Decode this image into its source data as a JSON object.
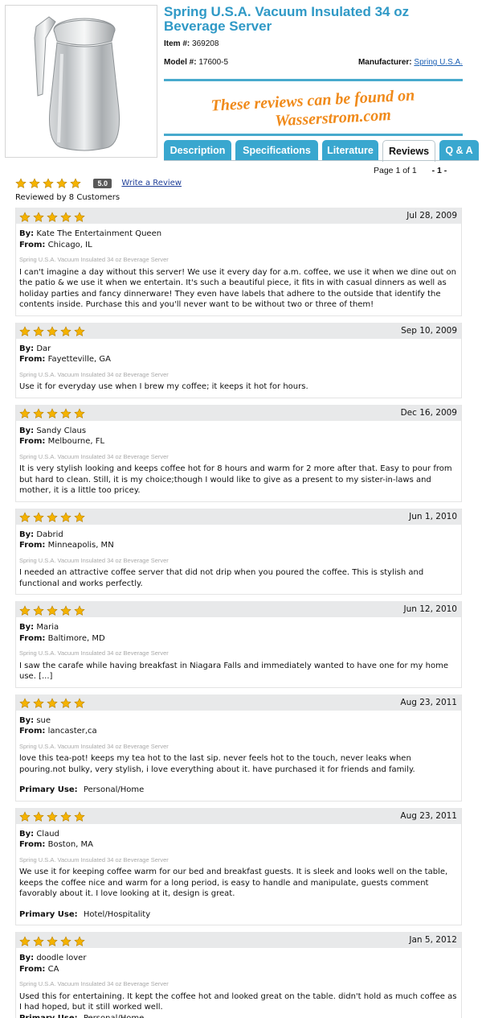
{
  "product": {
    "title": "Spring U.S.A. Vacuum Insulated 34 oz Beverage Server",
    "item_label": "Item #:",
    "item_number": "369208",
    "model_label": "Model #:",
    "model_number": "17600-5",
    "manufacturer_label": "Manufacturer:",
    "manufacturer": "Spring U.S.A."
  },
  "watermark": {
    "line1": "These reviews can be found on",
    "line2": "Wasserstrom.com",
    "color": "#f08a1a"
  },
  "tabs": [
    {
      "label": "Description",
      "active": false
    },
    {
      "label": "Specifications",
      "active": false
    },
    {
      "label": "Literature",
      "active": false
    },
    {
      "label": "Reviews",
      "active": true
    },
    {
      "label": "Q & A",
      "active": false
    }
  ],
  "pager": {
    "text": "Page 1 of 1",
    "current": "- 1 -"
  },
  "summary": {
    "rating": 5,
    "score": "5.0",
    "write_review": "Write a Review",
    "reviewed_by": "Reviewed by 8 Customers"
  },
  "labels": {
    "by": "By:",
    "from": "From:",
    "primary_use": "Primary Use:"
  },
  "colors": {
    "accent": "#2f99c6",
    "tab": "#39a7cf",
    "star": "#f5b300",
    "review_header": "#e8e9ea"
  },
  "reviews": [
    {
      "rating": 5,
      "date": "Jul 28, 2009",
      "by": "Kate The Entertainment Queen",
      "from": "Chicago, IL",
      "product": "Spring U.S.A. Vacuum Insulated 34 oz Beverage Server",
      "text": "I can't imagine a day without this server! We use it every day for a.m. coffee, we use it when we dine out on the patio & we use it when we entertain. It's such a beautiful piece, it fits in with casual dinners as well as holiday parties and fancy dinnerware! They even have labels that adhere to the outside that identify the contents inside. Purchase this and you'll never want to be without two or three of them!",
      "primary_use": ""
    },
    {
      "rating": 5,
      "date": "Sep 10, 2009",
      "by": "Dar",
      "from": "Fayetteville, GA",
      "product": "Spring U.S.A. Vacuum Insulated 34 oz Beverage Server",
      "text": "Use it for everyday use when I brew my coffee; it keeps it hot for hours.",
      "primary_use": ""
    },
    {
      "rating": 5,
      "date": "Dec 16, 2009",
      "by": "Sandy Claus",
      "from": "Melbourne, FL",
      "product": "Spring U.S.A. Vacuum Insulated 34 oz Beverage Server",
      "text": "It is very stylish looking and keeps coffee hot for 8 hours and warm for 2 more after that. Easy to pour from but hard to clean. Still, it is my choice;though I would like to give as a present to my sister-in-laws and mother, it is a little too pricey.",
      "primary_use": ""
    },
    {
      "rating": 5,
      "date": "Jun 1, 2010",
      "by": "Dabrid",
      "from": "Minneapolis, MN",
      "product": "Spring U.S.A. Vacuum Insulated 34 oz Beverage Server",
      "text": "I needed an attractive coffee server that did not drip when you poured the coffee. This is stylish and functional and works perfectly.",
      "primary_use": ""
    },
    {
      "rating": 5,
      "date": "Jun 12, 2010",
      "by": "Maria",
      "from": "Baltimore, MD",
      "product": "Spring U.S.A. Vacuum Insulated 34 oz Beverage Server",
      "text": "I saw the carafe while having breakfast in Niagara Falls and immediately wanted to have one for my home use. [...]",
      "primary_use": ""
    },
    {
      "rating": 5,
      "date": "Aug 23, 2011",
      "by": "sue",
      "from": "lancaster,ca",
      "product": "Spring U.S.A. Vacuum Insulated 34 oz Beverage Server",
      "text": "love this tea-pot! keeps my tea hot to the last sip. never feels hot to the touch, never leaks when pouring.not bulky, very stylish, i love everything about it. have purchased it for friends and family.",
      "primary_use": "Personal/Home"
    },
    {
      "rating": 5,
      "date": "Aug 23, 2011",
      "by": "Claud",
      "from": "Boston, MA",
      "product": "Spring U.S.A. Vacuum Insulated 34 oz Beverage Server",
      "text": "We use it for keeping coffee warm for our bed and breakfast guests. It is sleek and looks well on the table, keeps the coffee nice and warm for a long period, is easy to handle and manipulate, guests comment favorably about it. I love looking at it, design is great.",
      "primary_use": "Hotel/Hospitality"
    },
    {
      "rating": 5,
      "date": "Jan 5, 2012",
      "by": "doodle lover",
      "from": "CA",
      "product": "Spring U.S.A. Vacuum Insulated 34 oz Beverage Server",
      "text": "Used this for entertaining. It kept the coffee hot and looked great on the table. didn't hold as much coffee as I had hoped, but it still worked well.",
      "primary_use": "Personal/Home"
    }
  ]
}
